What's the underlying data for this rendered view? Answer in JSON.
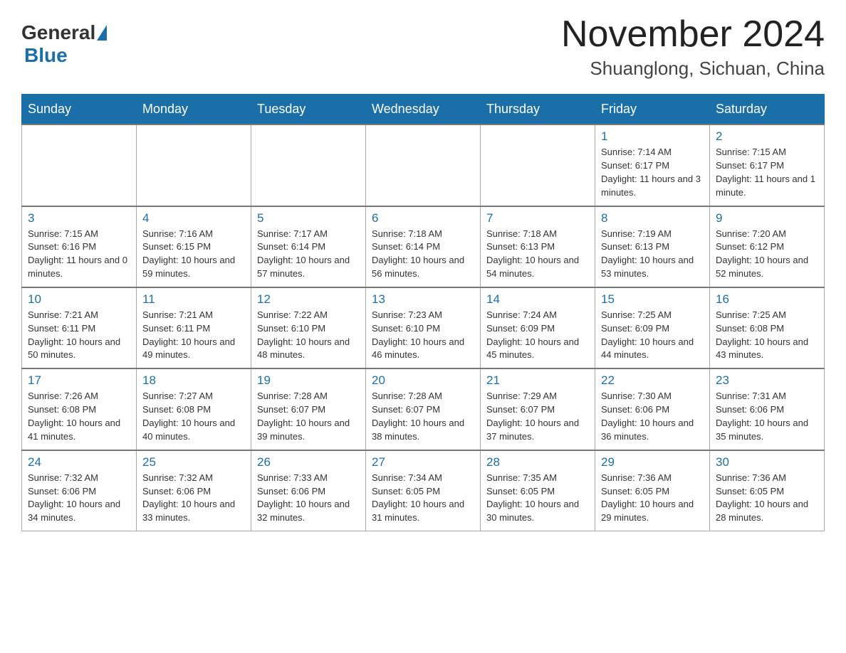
{
  "header": {
    "logo": {
      "general": "General",
      "blue": "Blue"
    },
    "title": "November 2024",
    "location": "Shuanglong, Sichuan, China"
  },
  "days_of_week": [
    "Sunday",
    "Monday",
    "Tuesday",
    "Wednesday",
    "Thursday",
    "Friday",
    "Saturday"
  ],
  "weeks": [
    [
      {
        "day": "",
        "info": ""
      },
      {
        "day": "",
        "info": ""
      },
      {
        "day": "",
        "info": ""
      },
      {
        "day": "",
        "info": ""
      },
      {
        "day": "",
        "info": ""
      },
      {
        "day": "1",
        "info": "Sunrise: 7:14 AM\nSunset: 6:17 PM\nDaylight: 11 hours and 3 minutes."
      },
      {
        "day": "2",
        "info": "Sunrise: 7:15 AM\nSunset: 6:17 PM\nDaylight: 11 hours and 1 minute."
      }
    ],
    [
      {
        "day": "3",
        "info": "Sunrise: 7:15 AM\nSunset: 6:16 PM\nDaylight: 11 hours and 0 minutes."
      },
      {
        "day": "4",
        "info": "Sunrise: 7:16 AM\nSunset: 6:15 PM\nDaylight: 10 hours and 59 minutes."
      },
      {
        "day": "5",
        "info": "Sunrise: 7:17 AM\nSunset: 6:14 PM\nDaylight: 10 hours and 57 minutes."
      },
      {
        "day": "6",
        "info": "Sunrise: 7:18 AM\nSunset: 6:14 PM\nDaylight: 10 hours and 56 minutes."
      },
      {
        "day": "7",
        "info": "Sunrise: 7:18 AM\nSunset: 6:13 PM\nDaylight: 10 hours and 54 minutes."
      },
      {
        "day": "8",
        "info": "Sunrise: 7:19 AM\nSunset: 6:13 PM\nDaylight: 10 hours and 53 minutes."
      },
      {
        "day": "9",
        "info": "Sunrise: 7:20 AM\nSunset: 6:12 PM\nDaylight: 10 hours and 52 minutes."
      }
    ],
    [
      {
        "day": "10",
        "info": "Sunrise: 7:21 AM\nSunset: 6:11 PM\nDaylight: 10 hours and 50 minutes."
      },
      {
        "day": "11",
        "info": "Sunrise: 7:21 AM\nSunset: 6:11 PM\nDaylight: 10 hours and 49 minutes."
      },
      {
        "day": "12",
        "info": "Sunrise: 7:22 AM\nSunset: 6:10 PM\nDaylight: 10 hours and 48 minutes."
      },
      {
        "day": "13",
        "info": "Sunrise: 7:23 AM\nSunset: 6:10 PM\nDaylight: 10 hours and 46 minutes."
      },
      {
        "day": "14",
        "info": "Sunrise: 7:24 AM\nSunset: 6:09 PM\nDaylight: 10 hours and 45 minutes."
      },
      {
        "day": "15",
        "info": "Sunrise: 7:25 AM\nSunset: 6:09 PM\nDaylight: 10 hours and 44 minutes."
      },
      {
        "day": "16",
        "info": "Sunrise: 7:25 AM\nSunset: 6:08 PM\nDaylight: 10 hours and 43 minutes."
      }
    ],
    [
      {
        "day": "17",
        "info": "Sunrise: 7:26 AM\nSunset: 6:08 PM\nDaylight: 10 hours and 41 minutes."
      },
      {
        "day": "18",
        "info": "Sunrise: 7:27 AM\nSunset: 6:08 PM\nDaylight: 10 hours and 40 minutes."
      },
      {
        "day": "19",
        "info": "Sunrise: 7:28 AM\nSunset: 6:07 PM\nDaylight: 10 hours and 39 minutes."
      },
      {
        "day": "20",
        "info": "Sunrise: 7:28 AM\nSunset: 6:07 PM\nDaylight: 10 hours and 38 minutes."
      },
      {
        "day": "21",
        "info": "Sunrise: 7:29 AM\nSunset: 6:07 PM\nDaylight: 10 hours and 37 minutes."
      },
      {
        "day": "22",
        "info": "Sunrise: 7:30 AM\nSunset: 6:06 PM\nDaylight: 10 hours and 36 minutes."
      },
      {
        "day": "23",
        "info": "Sunrise: 7:31 AM\nSunset: 6:06 PM\nDaylight: 10 hours and 35 minutes."
      }
    ],
    [
      {
        "day": "24",
        "info": "Sunrise: 7:32 AM\nSunset: 6:06 PM\nDaylight: 10 hours and 34 minutes."
      },
      {
        "day": "25",
        "info": "Sunrise: 7:32 AM\nSunset: 6:06 PM\nDaylight: 10 hours and 33 minutes."
      },
      {
        "day": "26",
        "info": "Sunrise: 7:33 AM\nSunset: 6:06 PM\nDaylight: 10 hours and 32 minutes."
      },
      {
        "day": "27",
        "info": "Sunrise: 7:34 AM\nSunset: 6:05 PM\nDaylight: 10 hours and 31 minutes."
      },
      {
        "day": "28",
        "info": "Sunrise: 7:35 AM\nSunset: 6:05 PM\nDaylight: 10 hours and 30 minutes."
      },
      {
        "day": "29",
        "info": "Sunrise: 7:36 AM\nSunset: 6:05 PM\nDaylight: 10 hours and 29 minutes."
      },
      {
        "day": "30",
        "info": "Sunrise: 7:36 AM\nSunset: 6:05 PM\nDaylight: 10 hours and 28 minutes."
      }
    ]
  ]
}
